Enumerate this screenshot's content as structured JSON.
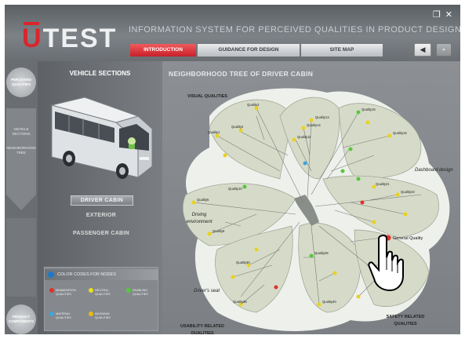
{
  "header": {
    "logo": "UTEST",
    "app_title": "INFORMATION SYSTEM FOR PERCEIVED QUALITIES IN PRODUCT DESIGN",
    "window_controls": [
      "restore-icon",
      "close-icon"
    ],
    "tabs": [
      {
        "label": "INTRODUCTION",
        "active": true
      },
      {
        "label": "GUIDANCE FOR DESIGN",
        "active": false
      },
      {
        "label": "SITE MAP",
        "active": false
      }
    ],
    "sound_icon": "speaker-icon",
    "options_icon": "options-icon"
  },
  "rail": {
    "top_button": "PERCEIVED QUALITIES",
    "item1": "VEHICLE SECTIONS",
    "item2": "NEIGHBORHOOD TREE",
    "bottom_button": "PRODUCT COMPONENTS"
  },
  "left_panel": {
    "title": "VEHICLE SECTIONS",
    "sections": [
      "DRIVER CABIN",
      "EXTERIOR",
      "PASSENGER CABIN"
    ],
    "selected": "DRIVER CABIN",
    "legend": {
      "title": "COLOR CODES FOR NODES",
      "items": [
        {
          "label": "MINIMIZATION",
          "sub": "QUALITIES",
          "color": "#e0302a"
        },
        {
          "label": "NEUTRAL",
          "sub": "QUALITIES",
          "color": "#e8e020"
        },
        {
          "label": "ENABLING",
          "sub": "QUALITIES",
          "color": "#56c83a"
        },
        {
          "label": "MATERIAL",
          "sub": "QUALITIES",
          "color": "#3aa6e0"
        },
        {
          "label": "MAXIMUM",
          "sub": "QUALITIES",
          "color": "#e8b818"
        }
      ]
    }
  },
  "main": {
    "title": "NEIGHBORHOOD TREE OF DRIVER CABIN",
    "groups": {
      "visual": "VISUAL QUALITIES",
      "dashboard": "Dashboard design",
      "driving_env": "Driving environment",
      "drivers_seat": "Driver's seat",
      "usability": "USABILITY RELATED QUALITIES",
      "safety": "SAFETY RELATED QUALITIES"
    },
    "highlight_node": "General Quality"
  },
  "colors": {
    "accent_red": "#d8262c",
    "node_yellow": "#e8d220",
    "node_green": "#56c83a",
    "node_blue": "#3aa6e0",
    "node_red": "#e0302a",
    "petal_fill": "#d6dbc9"
  }
}
